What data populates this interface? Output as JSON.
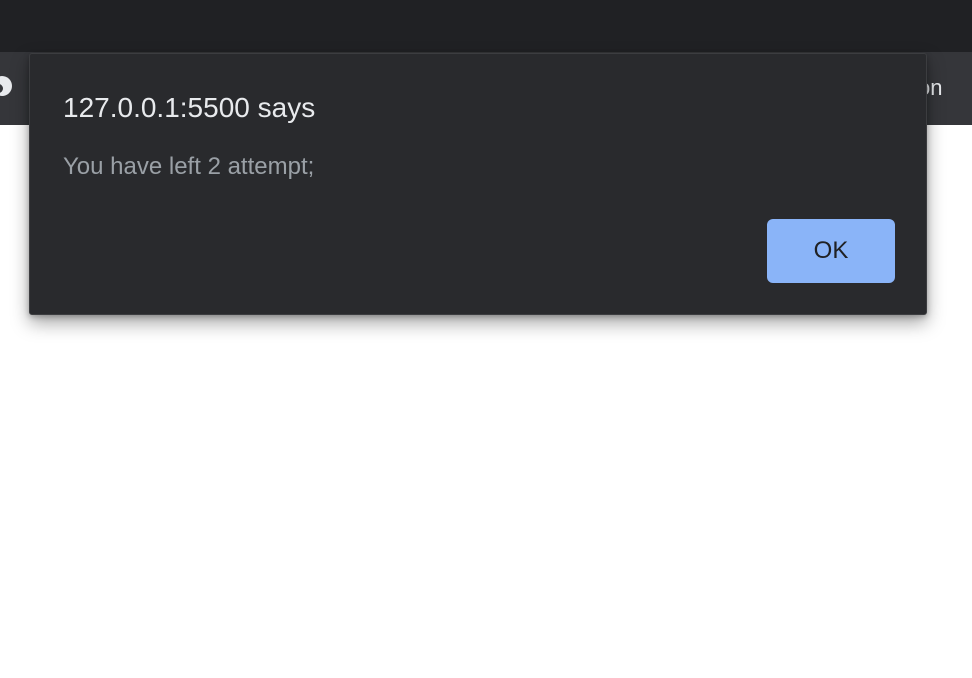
{
  "browser": {
    "toolbar_edge_text": "on",
    "toolbar_edge_icon": "profile-icon"
  },
  "dialog": {
    "title": "127.0.0.1:5500 says",
    "message": "You have left 2 attempt;",
    "ok_label": "OK"
  },
  "colors": {
    "titlebar": "#202124",
    "toolbar": "#35363a",
    "dialog_background": "#292a2d",
    "dialog_title": "#e8eaed",
    "dialog_message": "#9aa0a6",
    "button_background": "#8ab4f8",
    "button_text": "#202124",
    "page_background": "#ffffff"
  }
}
